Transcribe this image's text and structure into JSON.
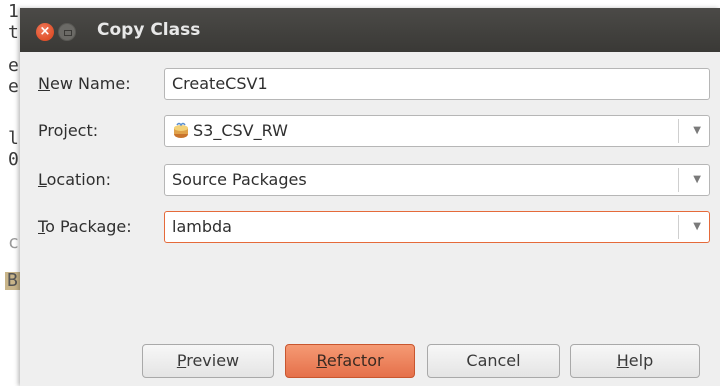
{
  "background_editor": {
    "chars": [
      "1",
      "t",
      "e",
      "e",
      "l",
      "0",
      "c",
      "B"
    ]
  },
  "dialog": {
    "title": "Copy Class",
    "fields": {
      "new_name": {
        "label_mnemonic": "N",
        "label_rest": "ew Name:",
        "value": "CreateCSV1"
      },
      "project": {
        "label": "Project:",
        "value": "S3_CSV_RW"
      },
      "location": {
        "label_mnemonic": "L",
        "label_rest": "ocation:",
        "value": "Source Packages"
      },
      "to_package": {
        "label_mnemonic": "T",
        "label_rest": "o Package:",
        "value": "lambda"
      }
    },
    "buttons": {
      "preview_mnemonic": "P",
      "preview_rest": "review",
      "refactor_mnemonic": "R",
      "refactor_rest": "efactor",
      "cancel": "Cancel",
      "help_mnemonic": "H",
      "help_rest": "elp"
    },
    "colors": {
      "accent": "#e5704a",
      "titlebar": "#3c3b37",
      "close_button": "#e0502a"
    }
  }
}
